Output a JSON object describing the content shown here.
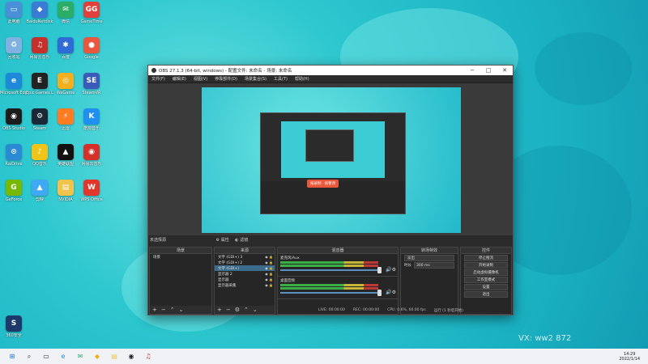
{
  "desktop_icons": [
    {
      "label": "此电脑",
      "icon": "computer-icon",
      "color": "#4a90d9",
      "glyph": "▭"
    },
    {
      "label": "BaiduNetdisk",
      "icon": "baidu-icon",
      "color": "#3a7bd5",
      "glyph": "◆"
    },
    {
      "label": "微信",
      "icon": "wechat-icon",
      "color": "#2aae67",
      "glyph": "✉"
    },
    {
      "label": "GameTime",
      "icon": "game-icon",
      "color": "#e0413d",
      "glyph": "GG"
    },
    {
      "label": "回收站",
      "icon": "recycle-bin-icon",
      "color": "#7fb2e0",
      "glyph": "♻"
    },
    {
      "label": "网易云音乐",
      "icon": "music-icon",
      "color": "#c5312a",
      "glyph": "♫"
    },
    {
      "label": "百度",
      "icon": "paw-icon",
      "color": "#2f6bd6",
      "glyph": "✱"
    },
    {
      "label": "Google",
      "icon": "chrome-icon",
      "color": "#e9573f",
      "glyph": "●"
    },
    {
      "label": "Microsoft Edge",
      "icon": "edge-icon",
      "color": "#1c8ad8",
      "glyph": "e"
    },
    {
      "label": "Epic Games Launcher",
      "icon": "epic-icon",
      "color": "#222222",
      "glyph": "E"
    },
    {
      "label": "WeGame",
      "icon": "wegame-icon",
      "color": "#f2b01e",
      "glyph": "◎"
    },
    {
      "label": "SteamVR",
      "icon": "steamvr-icon",
      "color": "#3a5bb8",
      "glyph": "SE"
    },
    {
      "label": "OBS Studio",
      "icon": "obs-icon",
      "color": "#1c1c1c",
      "glyph": "◉"
    },
    {
      "label": "Steam",
      "icon": "steam-icon",
      "color": "#1b2838",
      "glyph": "⚙"
    },
    {
      "label": "迅雷",
      "icon": "thunder-icon",
      "color": "#ff7b22",
      "glyph": "⚡"
    },
    {
      "label": "酷狗音乐",
      "icon": "kugou-icon",
      "color": "#1f8ff0",
      "glyph": "K"
    },
    {
      "label": "RaiDrive",
      "icon": "drive-icon",
      "color": "#2a8ad3",
      "glyph": "⊙"
    },
    {
      "label": "QQ音乐",
      "icon": "qqmusic-icon",
      "color": "#f0c419",
      "glyph": "♪"
    },
    {
      "label": "英雄联盟",
      "icon": "lol-icon",
      "color": "#111111",
      "glyph": "▲"
    },
    {
      "label": "网易云音乐",
      "icon": "netease-icon",
      "color": "#d5312b",
      "glyph": "◉"
    },
    {
      "label": "GeForce",
      "icon": "geforce-icon",
      "color": "#76b900",
      "glyph": "G"
    },
    {
      "label": "剪映",
      "icon": "capcut-icon",
      "color": "#3fa9f5",
      "glyph": "▲"
    },
    {
      "label": "NVIDIA",
      "icon": "folder-icon",
      "color": "#f1c34b",
      "glyph": "▤"
    },
    {
      "label": "WPS Office",
      "icon": "wps-icon",
      "color": "#e2362d",
      "glyph": "W"
    },
    {
      "label": "360安全",
      "icon": "security-icon",
      "color": "#1b3a6b",
      "glyph": "S"
    }
  ],
  "obs": {
    "title": "OBS 27.1.3 (64-bit, windows) - 配置文件: 未命名 - 场景: 未命名",
    "menu": [
      "文件(F)",
      "编辑(E)",
      "视图(V)",
      "停靠部件(D)",
      "场景集合(S)",
      "工具(T)",
      "帮助(H)"
    ],
    "scene_label": "未选择源",
    "props_btn": "属性",
    "filters_btn": "滤镜",
    "docks": {
      "scenes": {
        "header": "场景",
        "items": [
          "场景"
        ]
      },
      "sources": {
        "header": "来源",
        "items": [
          "文字 (GDI+) 3",
          "文字 (GDI+) 2",
          "文字 (GDI+)",
          "显示器 2",
          "显示器",
          "显示器采集"
        ]
      },
      "mixer": {
        "header": "混音器",
        "channels": [
          {
            "name": "麦克风/Aux"
          },
          {
            "name": "桌面音频"
          }
        ]
      },
      "transitions": {
        "header": "转场特效",
        "type": "淡出",
        "duration_label": "时长",
        "duration": "300 ms"
      },
      "controls": {
        "header": "控件",
        "buttons": [
          "停止推流",
          "开始录制",
          "启动虚拟摄像机",
          "工作室模式",
          "设置",
          "退出"
        ]
      }
    },
    "status": {
      "live": "LIVE: 00:00:00",
      "rec": "REC: 00:00:00",
      "cpu": "CPU: 0.6%, 60.00 fps",
      "extra": "运行 (1 秒后开始)"
    },
    "rec_banner": "按录制 · 按暂停"
  },
  "taskbar": {
    "time": "14:29",
    "date": "2022/1/14",
    "icons": [
      "windows-icon",
      "search-icon",
      "taskview-icon",
      "edge-icon",
      "wechat-icon",
      "qqgame-icon",
      "folder-icon",
      "obs-icon",
      "netease-icon"
    ]
  },
  "watermark": "VX: ww2 872"
}
